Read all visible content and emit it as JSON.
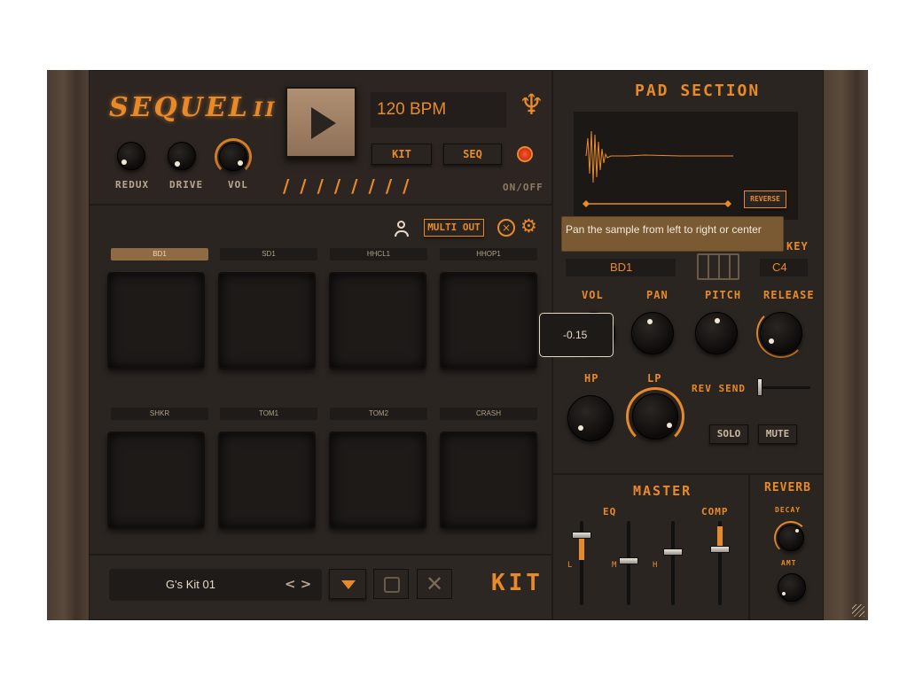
{
  "app": {
    "logo": "SEQUEL",
    "logo_suffix": "II",
    "bpm": "120 BPM",
    "kit_tab": "KIT",
    "seq_tab": "SEQ",
    "onoff": "ON/OFF"
  },
  "top_knobs": [
    {
      "label": "REDUX"
    },
    {
      "label": "DRIVE"
    },
    {
      "label": "VOL"
    }
  ],
  "pads_header": {
    "multi_out": "MULTI OUT"
  },
  "pads_row1": [
    "BD1",
    "SD1",
    "HHCL1",
    "HHOP1"
  ],
  "pads_row2": [
    "SHKR",
    "TOM1",
    "TOM2",
    "CRASH"
  ],
  "kit_bar": {
    "kit_name": "G's Kit 01",
    "nav_arrows": "< >",
    "kit_label": "KIT"
  },
  "pad_section": {
    "title": "PAD SECTION",
    "reverse": "REVERSE",
    "tooltip": "Pan the sample from left to right or center",
    "key_label": "KEY",
    "pad_name": "BD1",
    "key_value": "C4",
    "vol": "VOL",
    "pan": "PAN",
    "pitch": "PITCH",
    "release": "RELEASE",
    "hp": "HP",
    "lp": "LP",
    "rev_send": "REV SEND",
    "solo": "SOLO",
    "mute": "MUTE",
    "value_popup": "-0.15"
  },
  "master": {
    "title": "MASTER",
    "eq": "EQ",
    "comp": "COMP",
    "l": "L",
    "m": "M",
    "h": "H"
  },
  "reverb": {
    "title": "REVERB",
    "decay": "DECAY",
    "amt": "AMT"
  },
  "colors": {
    "accent": "#e88a2a",
    "background": "#2e2824",
    "wood": "#4f4033"
  }
}
